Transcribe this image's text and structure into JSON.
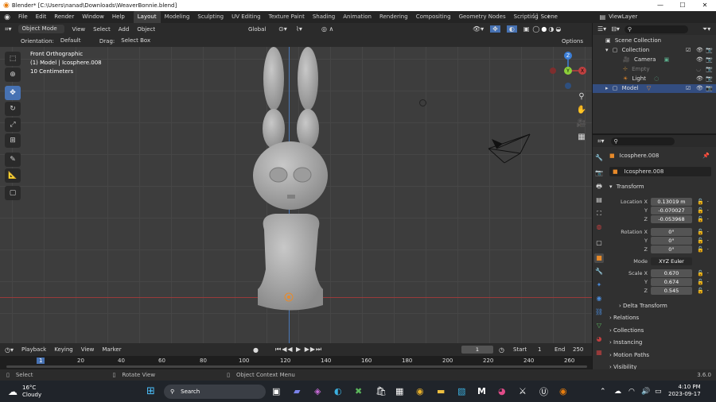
{
  "titlebar": {
    "title": "Blender* [C:\\Users\\nanad\\Downloads\\WeaverBonnie.blend]",
    "min": "—",
    "max": "☐",
    "close": "✕"
  },
  "menubar": {
    "menus": [
      "File",
      "Edit",
      "Render",
      "Window",
      "Help"
    ],
    "workspaces": [
      "Layout",
      "Modeling",
      "Sculpting",
      "UV Editing",
      "Texture Paint",
      "Shading",
      "Animation",
      "Rendering",
      "Compositing",
      "Geometry Nodes",
      "Scripting"
    ],
    "add_ws": "+",
    "scene": "Scene",
    "view_layer": "ViewLayer"
  },
  "viewport_header": {
    "mode": "Object Mode",
    "menus": [
      "View",
      "Select",
      "Add",
      "Object"
    ],
    "transform": "Global",
    "orientation_label": "Orientation:",
    "orientation": "Default",
    "drag_label": "Drag:",
    "drag": "Select Box",
    "options": "Options"
  },
  "overlay": {
    "view_name": "Front Orthographic",
    "object": "(1) Model | Icosphere.008",
    "scale": "10 Centimeters"
  },
  "gizmo": {
    "z": "Z",
    "y": "Y",
    "x": "X"
  },
  "outliner": {
    "root": "Scene Collection",
    "items": [
      {
        "label": "Collection"
      },
      {
        "label": "Camera"
      },
      {
        "label": "Empty"
      },
      {
        "label": "Light"
      },
      {
        "label": "Model"
      }
    ]
  },
  "properties": {
    "object": "Icosphere.008",
    "object_data": "Icosphere.008",
    "transform": "Transform",
    "location_label": "Location X",
    "y_label": "Y",
    "z_label": "Z",
    "location": [
      "0.13019 m",
      "-0.070027",
      "-0.053968"
    ],
    "rotation_label": "Rotation X",
    "rotation": [
      "0°",
      "0°",
      "0°"
    ],
    "mode_label": "Mode",
    "mode": "XYZ Euler",
    "scale_label": "Scale X",
    "scale": [
      "0.670",
      "0.674",
      "0.545"
    ],
    "sections": [
      "Delta Transform",
      "Relations",
      "Collections",
      "Instancing",
      "Motion Paths",
      "Visibility"
    ]
  },
  "timeline": {
    "menus": [
      "Playback",
      "Keying",
      "View",
      "Marker"
    ],
    "current": "1",
    "start_label": "Start",
    "start": "1",
    "end_label": "End",
    "end": "250",
    "ticks": [
      "1",
      "20",
      "40",
      "60",
      "80",
      "100",
      "120",
      "140",
      "160",
      "180",
      "200",
      "220",
      "240",
      "260"
    ]
  },
  "statusbar": {
    "select": "Select",
    "rotate": "Rotate View",
    "context": "Object Context Menu",
    "version": "3.6.0"
  },
  "taskbar": {
    "temp": "16°C",
    "weather": "Cloudy",
    "search": "Search",
    "time": "4:10 PM",
    "date": "2023-09-17"
  },
  "colors": {
    "accent": "#4772b3",
    "x_axis": "#c04040",
    "y_axis": "#8ccf3a",
    "z_axis": "#3c7fd8",
    "object_active": "#e88a2a"
  }
}
